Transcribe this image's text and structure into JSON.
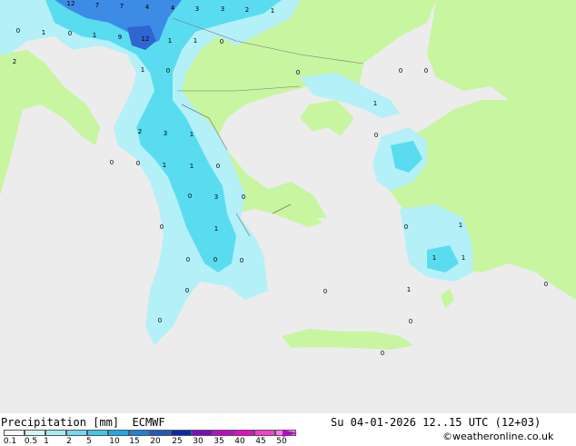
{
  "title": "Precipitation [mm]",
  "model": "ECMWF",
  "valid_time": "Su 04-01-2026 12..15 UTC (12+03)",
  "credit": "©weatheronline.co.uk",
  "colors": {
    "sea": "#ececec",
    "land": "#c8f5a0",
    "precip_light": "#b4f0f8",
    "precip_mid": "#5adcf0",
    "precip_heavy": "#3c8ce6",
    "precip_max": "#3264d2"
  },
  "legend": {
    "labels": [
      "0.1",
      "0.5",
      "1",
      "2",
      "5",
      "10",
      "15",
      "20",
      "25",
      "30",
      "35",
      "40",
      "45",
      "50"
    ],
    "colors": [
      "#f5fafa",
      "#d2f5fa",
      "#a5ebf5",
      "#6edcf0",
      "#3cc8eb",
      "#1eaae6",
      "#1e82d7",
      "#1e5ac3",
      "#0a28af",
      "#7d0ac3",
      "#be0ac8",
      "#e60ac8",
      "#fa3cd2",
      "#ff78e6"
    ]
  },
  "values": [
    {
      "text": "12"
    },
    {
      "text": "7"
    },
    {
      "text": "7"
    },
    {
      "text": "4"
    },
    {
      "text": "4"
    },
    {
      "text": "3"
    },
    {
      "text": "3"
    },
    {
      "text": "2"
    },
    {
      "text": "1"
    },
    {
      "text": "0"
    },
    {
      "text": "1"
    },
    {
      "text": "0"
    },
    {
      "text": "1"
    },
    {
      "text": "9"
    },
    {
      "text": "12"
    },
    {
      "text": "1"
    },
    {
      "text": "1"
    },
    {
      "text": "0"
    },
    {
      "text": "2"
    },
    {
      "text": "1"
    },
    {
      "text": "0"
    },
    {
      "text": "0"
    },
    {
      "text": "0"
    },
    {
      "text": "0"
    },
    {
      "text": "1"
    },
    {
      "text": "2"
    },
    {
      "text": "3"
    },
    {
      "text": "1"
    },
    {
      "text": "0"
    },
    {
      "text": "0"
    },
    {
      "text": "0"
    },
    {
      "text": "1"
    },
    {
      "text": "1"
    },
    {
      "text": "0"
    },
    {
      "text": "0"
    },
    {
      "text": "3"
    },
    {
      "text": "0"
    },
    {
      "text": "0"
    },
    {
      "text": "1"
    },
    {
      "text": "0"
    },
    {
      "text": "1"
    },
    {
      "text": "0"
    },
    {
      "text": "0"
    },
    {
      "text": "0"
    },
    {
      "text": "1"
    },
    {
      "text": "1"
    },
    {
      "text": "0"
    },
    {
      "text": "0"
    },
    {
      "text": "1"
    },
    {
      "text": "0"
    },
    {
      "text": "0"
    },
    {
      "text": "0"
    },
    {
      "text": "0"
    }
  ]
}
